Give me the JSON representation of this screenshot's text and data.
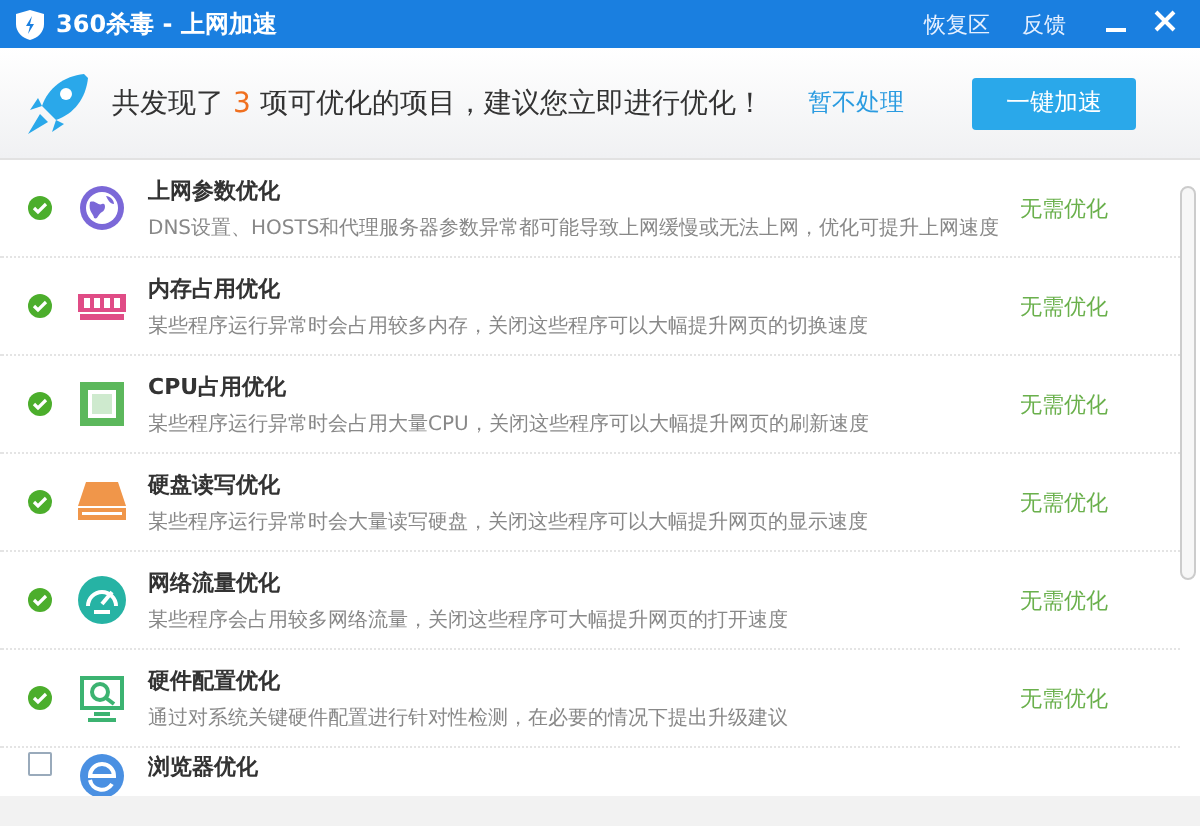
{
  "window": {
    "title": "360杀毒 - 上网加速",
    "links": [
      "恢复区",
      "反馈"
    ]
  },
  "summary": {
    "before": "共发现了",
    "count": "3",
    "after": "项可优化的项目，建议您立即进行优化！",
    "skip_link": "暂不处理",
    "action_button": "一键加速"
  },
  "items": [
    {
      "kind": "globe",
      "checked": true,
      "title": "上网参数优化",
      "description": "DNS设置、HOSTS和代理服务器参数异常都可能导致上网缓慢或无法上网，优化可提升上网速度",
      "status": "无需优化"
    },
    {
      "kind": "memory",
      "checked": true,
      "title": "内存占用优化",
      "description": "某些程序运行异常时会占用较多内存，关闭这些程序可以大幅提升网页的切换速度",
      "status": "无需优化"
    },
    {
      "kind": "cpu",
      "checked": true,
      "title": "CPU占用优化",
      "description": "某些程序运行异常时会占用大量CPU，关闭这些程序可以大幅提升网页的刷新速度",
      "status": "无需优化"
    },
    {
      "kind": "disk",
      "checked": true,
      "title": "硬盘读写优化",
      "description": "某些程序运行异常时会大量读写硬盘，关闭这些程序可以大幅提升网页的显示速度",
      "status": "无需优化"
    },
    {
      "kind": "gauge",
      "checked": true,
      "title": "网络流量优化",
      "description": "某些程序会占用较多网络流量，关闭这些程序可大幅提升网页的打开速度",
      "status": "无需优化"
    },
    {
      "kind": "monitor",
      "checked": true,
      "title": "硬件配置优化",
      "description": "通过对系统关键硬件配置进行针对性检测，在必要的情况下提出升级建议",
      "status": "无需优化"
    },
    {
      "kind": "browser",
      "checked": false,
      "title": "浏览器优化"
    }
  ]
}
